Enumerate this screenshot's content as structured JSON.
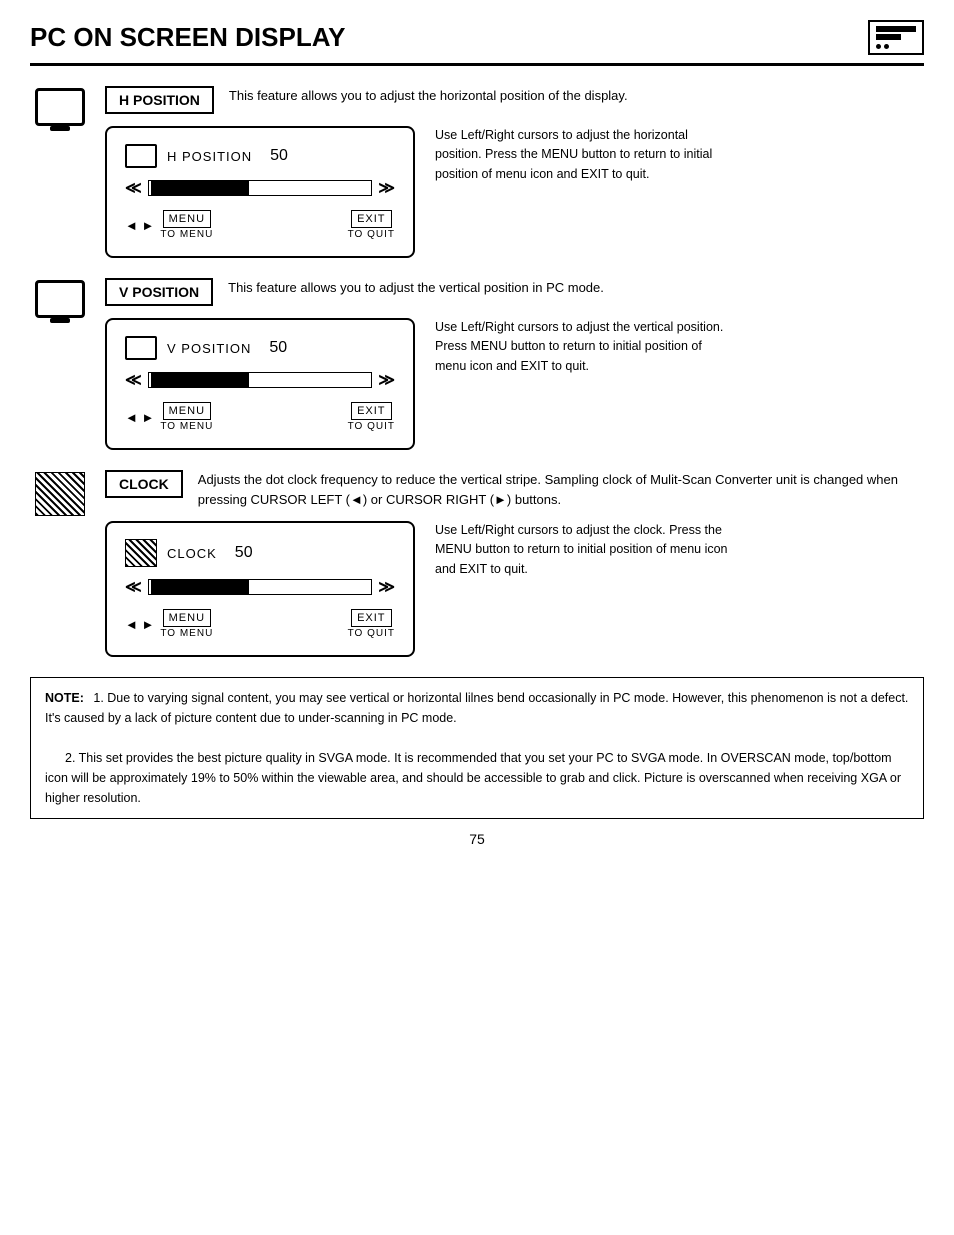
{
  "page": {
    "title": "PC ON SCREEN DISPLAY",
    "number": "75"
  },
  "sections": [
    {
      "id": "h-position",
      "icon_type": "monitor",
      "label": "H POSITION",
      "description": "This feature allows you to adjust the horizontal position of the display.",
      "osd_label": "H POSITION",
      "osd_value": "50",
      "osd_desc": "Use Left/Right cursors to adjust the horizontal position. Press the MENU button to return to initial position of menu icon and EXIT to quit.",
      "slider_fill_pct": 45
    },
    {
      "id": "v-position",
      "icon_type": "monitor",
      "label": "V POSITION",
      "description": "This feature allows you to adjust the vertical position in PC mode.",
      "osd_label": "V POSITION",
      "osd_value": "50",
      "osd_desc": "Use Left/Right cursors to adjust the vertical position. Press MENU button to return to initial position of menu icon and EXIT to quit.",
      "slider_fill_pct": 45
    },
    {
      "id": "clock",
      "icon_type": "clock",
      "label": "CLOCK",
      "description": "Adjusts the dot clock frequency to reduce the vertical stripe.  Sampling clock of Mulit-Scan Converter unit is changed when pressing CURSOR LEFT (◄) or CURSOR RIGHT (►) buttons.",
      "osd_label": "CLOCK",
      "osd_value": "50",
      "osd_desc": "Use Left/Right cursors to adjust the clock. Press the MENU button to return to initial position of menu icon and EXIT to quit.",
      "slider_fill_pct": 45
    }
  ],
  "controls": {
    "menu_label": "MENU",
    "exit_label": "EXIT",
    "to_menu": "TO  MENU",
    "to_quit": "TO  QUIT"
  },
  "note": {
    "label": "NOTE:",
    "items": [
      "1. Due to varying signal content, you may see vertical or horizontal lilnes bend occasionally in PC mode.  However, this phenomenon is not a defect.  It's caused by a lack of picture content due to under-scanning in PC mode.",
      "2. This set provides the best picture quality in SVGA mode.  It is recommended that you set your PC to SVGA mode.  In OVERSCAN mode, top/bottom icon will be approximately 19% to 50% within the viewable area, and should be accessible to grab and click.  Picture is overscanned when receiving XGA or higher resolution."
    ]
  }
}
